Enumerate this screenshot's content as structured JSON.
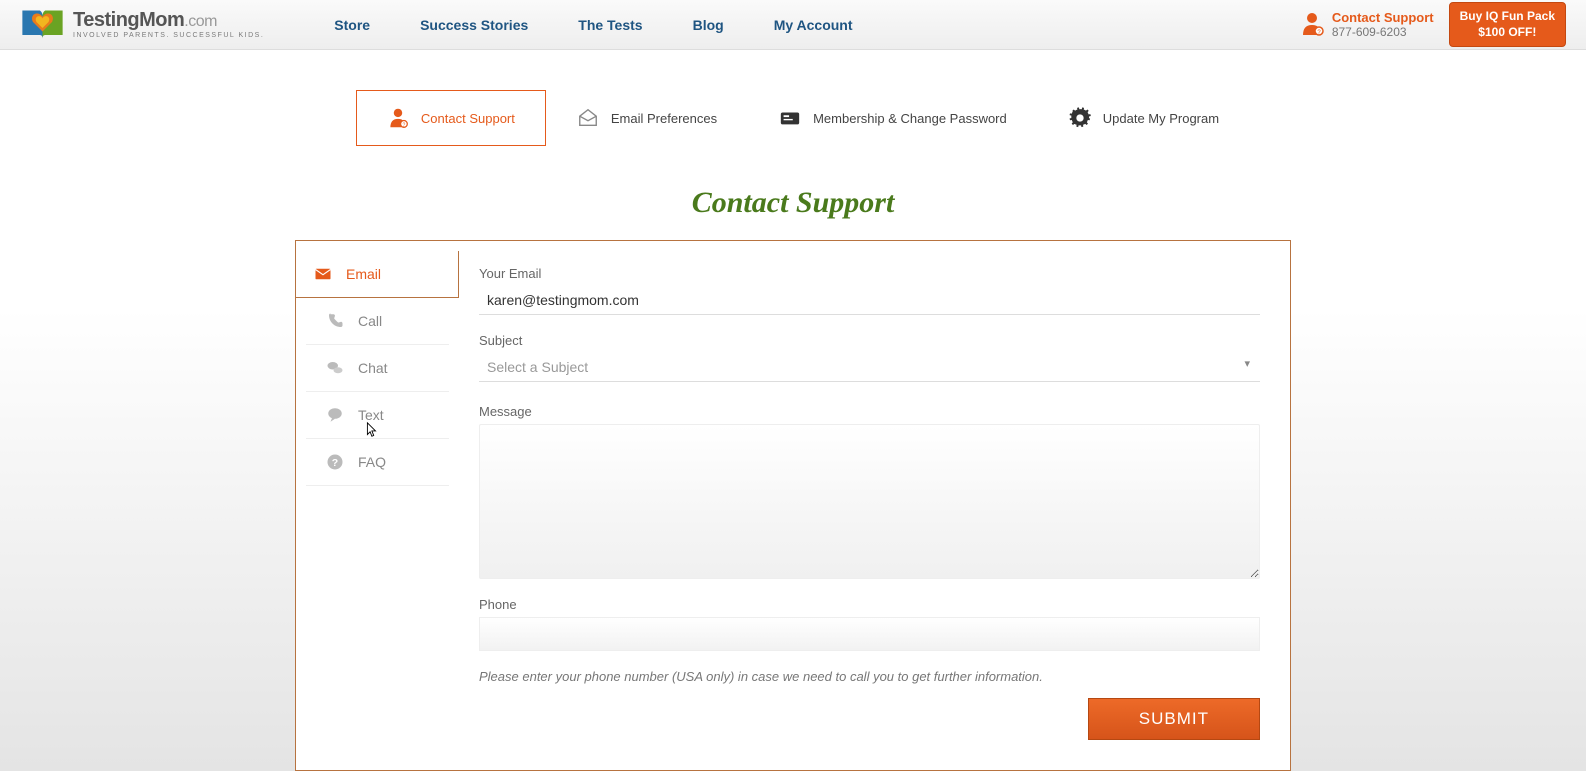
{
  "header": {
    "brand_main": "TestingMom",
    "brand_suffix": ".com",
    "brand_tag": "INVOLVED PARENTS. SUCCESSFUL KIDS.",
    "nav": [
      "Store",
      "Success Stories",
      "The Tests",
      "Blog",
      "My Account"
    ],
    "contact_label": "Contact Support",
    "contact_phone": "877-609-6203",
    "buy_line1": "Buy IQ Fun Pack",
    "buy_line2": "$100 OFF!"
  },
  "tabs": {
    "items": [
      {
        "label": "Contact Support",
        "icon": "support-person-icon",
        "active": true
      },
      {
        "label": "Email Preferences",
        "icon": "envelope-open-icon",
        "active": false
      },
      {
        "label": "Membership & Change Password",
        "icon": "id-card-icon",
        "active": false
      },
      {
        "label": "Update My Program",
        "icon": "gear-icon",
        "active": false
      }
    ]
  },
  "title": "Contact Support",
  "sidebar": {
    "items": [
      {
        "label": "Email",
        "icon": "envelope-icon",
        "active": true
      },
      {
        "label": "Call",
        "icon": "phone-icon",
        "active": false
      },
      {
        "label": "Chat",
        "icon": "chat-bubbles-icon",
        "active": false
      },
      {
        "label": "Text",
        "icon": "speech-icon",
        "active": false
      },
      {
        "label": "FAQ",
        "icon": "question-circle-icon",
        "active": false
      }
    ]
  },
  "form": {
    "email_label": "Your Email",
    "email_value": "karen@testingmom.com",
    "subject_label": "Subject",
    "subject_placeholder": "Select a Subject",
    "message_label": "Message",
    "message_value": "",
    "phone_label": "Phone",
    "phone_value": "",
    "phone_help": "Please enter your phone number (USA only) in case we need to call you to get further information.",
    "submit_label": "SUBMIT"
  }
}
